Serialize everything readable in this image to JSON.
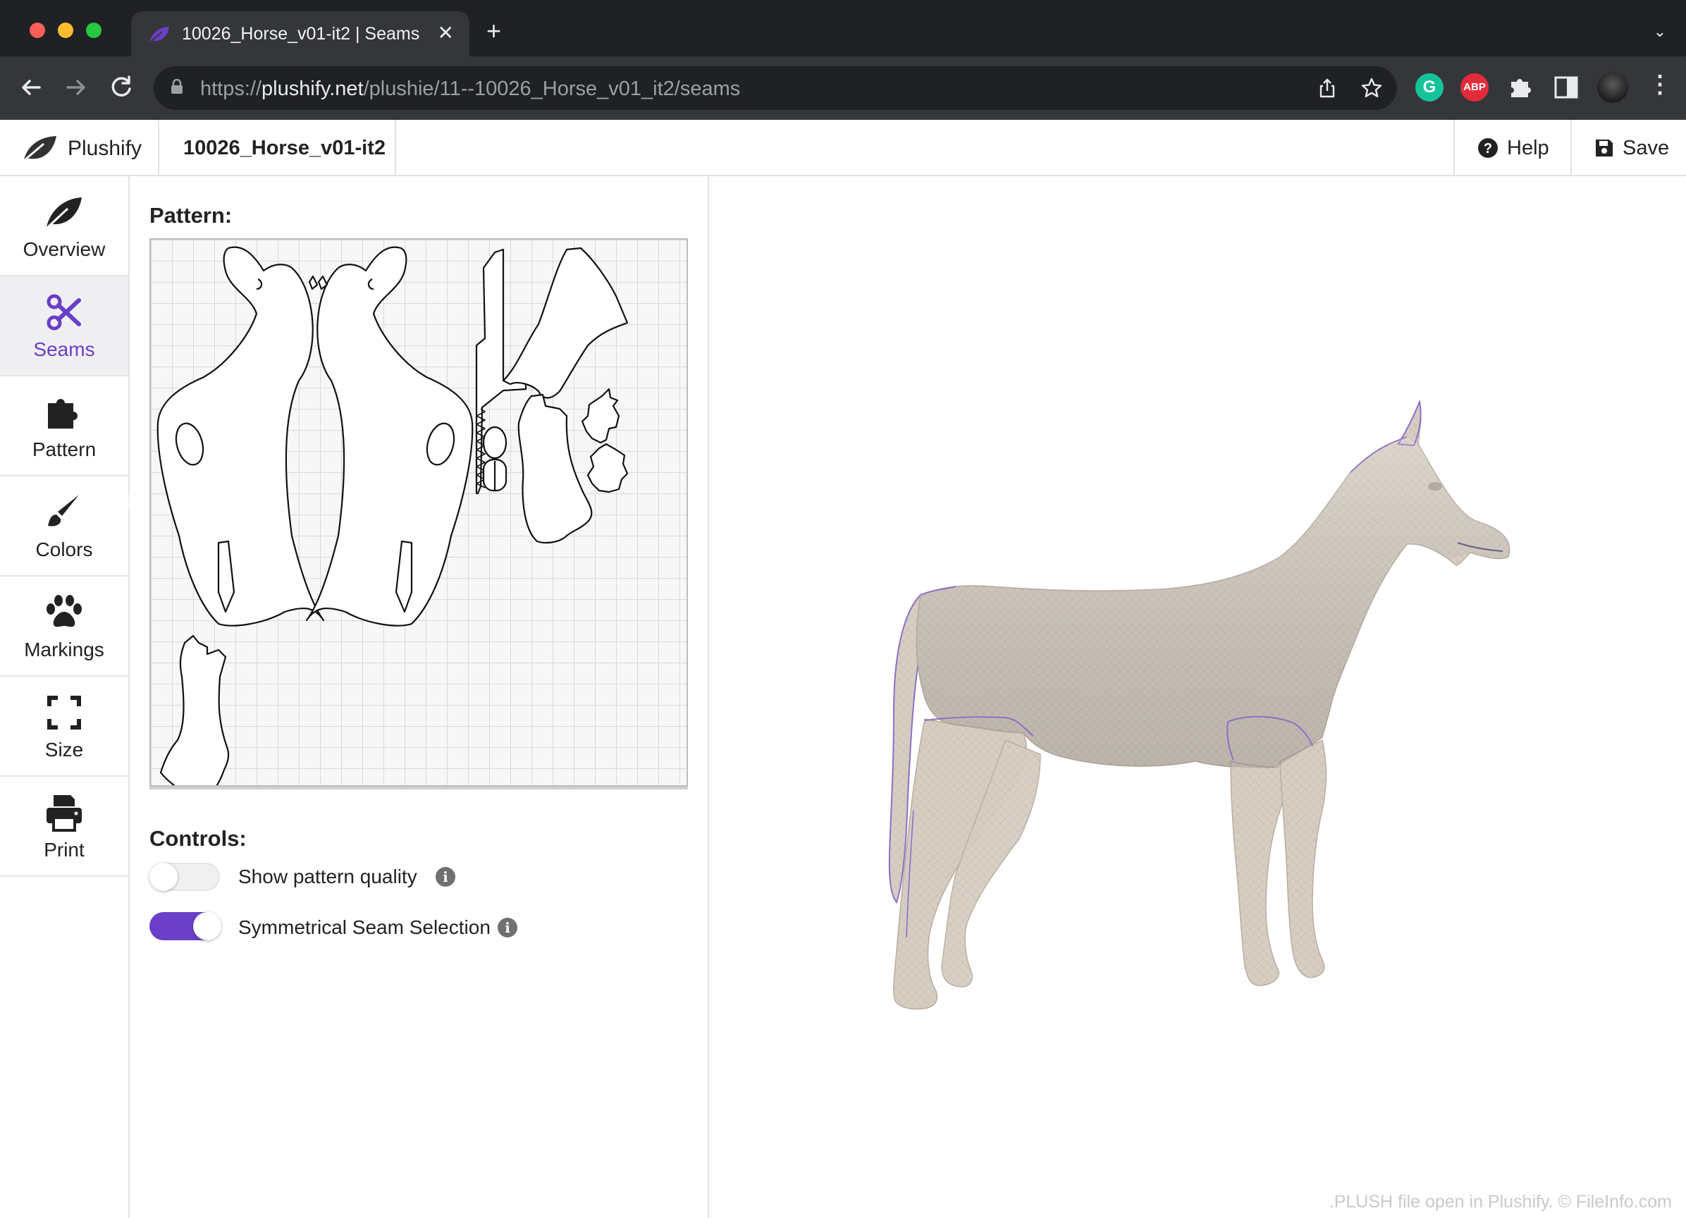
{
  "browser": {
    "tab_title": "10026_Horse_v01-it2 | Seams",
    "url_scheme": "https://",
    "url_host": "plushify.net",
    "url_path": "/plushie/11--10026_Horse_v01_it2/seams",
    "ext_grammarly_icon": "grammarly-icon",
    "ext_adblock_label": "ABP",
    "colors": {
      "frame": "#202124",
      "toolbar": "#35363a",
      "grammarly": "#15c39a",
      "adblock": "#e42b3c"
    }
  },
  "app": {
    "brand": "Plushify",
    "file_title": "10026_Horse_v01-it2",
    "help_label": "Help",
    "save_label": "Save",
    "accent": "#6b3fc7"
  },
  "sidebar": {
    "items": [
      {
        "label": "Overview",
        "icon": "leaf-icon"
      },
      {
        "label": "Seams",
        "icon": "scissors-icon",
        "active": true
      },
      {
        "label": "Pattern",
        "icon": "puzzle-icon"
      },
      {
        "label": "Colors",
        "icon": "paintbrush-icon"
      },
      {
        "label": "Markings",
        "icon": "paw-icon"
      },
      {
        "label": "Size",
        "icon": "expand-icon"
      },
      {
        "label": "Print",
        "icon": "printer-icon"
      }
    ]
  },
  "panel": {
    "pattern_title": "Pattern:",
    "controls_title": "Controls:",
    "controls": [
      {
        "label": "Show pattern quality",
        "on": false
      },
      {
        "label": "Symmetrical Seam Selection",
        "on": true
      }
    ]
  },
  "footnote": ".PLUSH file open in Plushify. © FileInfo.com"
}
